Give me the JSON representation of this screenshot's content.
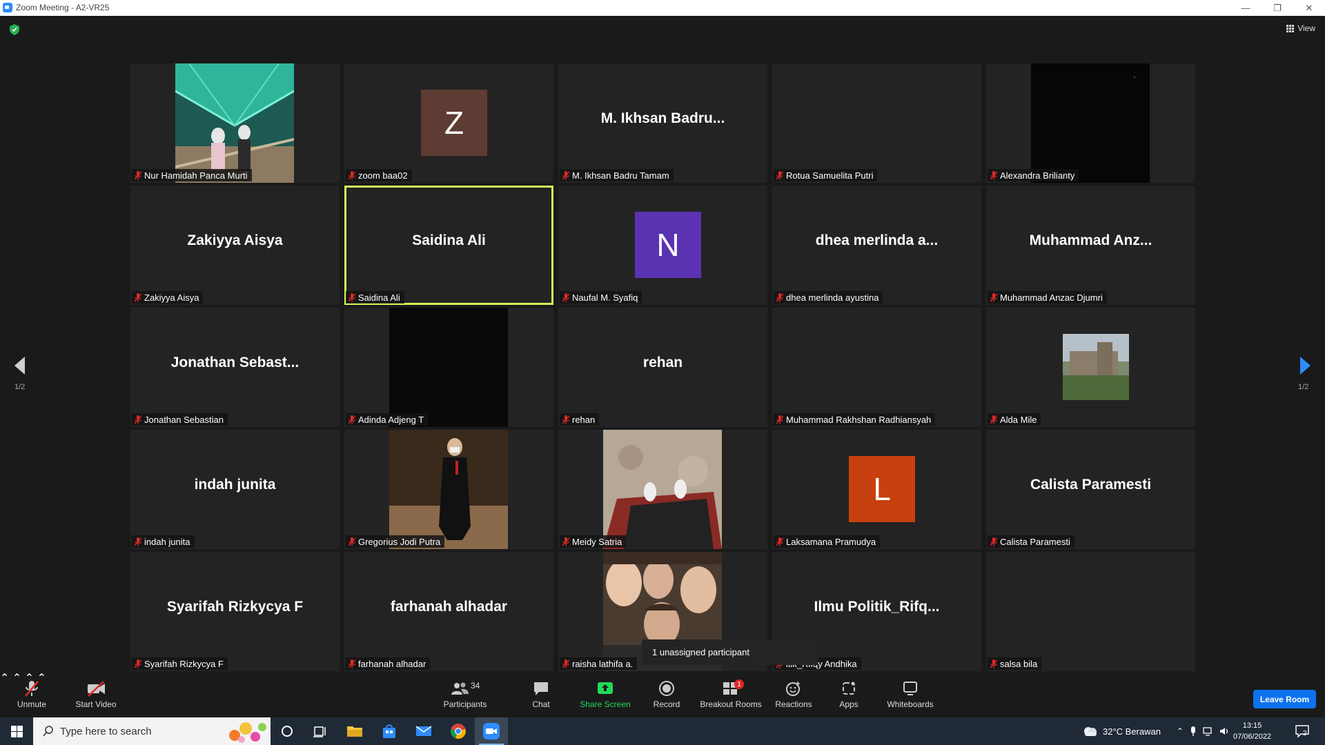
{
  "window": {
    "title": "Zoom Meeting - A2-VR25"
  },
  "view_button": "View",
  "pagination": {
    "left": "1/2",
    "right": "1/2"
  },
  "tiles": [
    {
      "name": "Nur Hamidah Panca Murti",
      "big": "",
      "type": "video",
      "video": "bridge"
    },
    {
      "name": "zoom baa02",
      "big": "",
      "type": "avatar",
      "letter": "Z",
      "color": "#5e3b33"
    },
    {
      "name": "M. Ikhsan Badru Tamam",
      "big": "M. Ikhsan Badru...",
      "type": "name"
    },
    {
      "name": "Rotua Samuelita Putri",
      "big": "",
      "type": "blank"
    },
    {
      "name": "Alexandra Brilianty",
      "big": "",
      "type": "video",
      "video": "dark"
    },
    {
      "name": "Zakiyya Aisya",
      "big": "Zakiyya Aisya",
      "type": "name"
    },
    {
      "name": "Saidina Ali",
      "big": "Saidina Ali",
      "type": "name",
      "active": true
    },
    {
      "name": "Naufal M. Syafiq",
      "big": "",
      "type": "avatar",
      "letter": "N",
      "color": "#5b33b2"
    },
    {
      "name": "dhea merlinda ayustina",
      "big": "dhea merlinda a...",
      "type": "name"
    },
    {
      "name": "Muhammad Anzac Djumri",
      "big": "Muhammad  Anz...",
      "type": "name"
    },
    {
      "name": "Jonathan Sebastian",
      "big": "Jonathan  Sebast...",
      "type": "name"
    },
    {
      "name": "Adinda Adjeng T",
      "big": "",
      "type": "video",
      "video": "black"
    },
    {
      "name": "rehan",
      "big": "rehan",
      "type": "name"
    },
    {
      "name": "Muhammad Rakhshan Radhiansyah",
      "big": "",
      "type": "blank"
    },
    {
      "name": "Alda Mile",
      "big": "",
      "type": "thumb"
    },
    {
      "name": "indah junita",
      "big": "indah junita",
      "type": "name"
    },
    {
      "name": "Gregorius Jodi Putra",
      "big": "",
      "type": "video",
      "video": "suit"
    },
    {
      "name": "Meidy Satria",
      "big": "",
      "type": "video",
      "video": "floor"
    },
    {
      "name": "Laksamana Pramudya",
      "big": "",
      "type": "avatar",
      "letter": "L",
      "color": "#c8400e"
    },
    {
      "name": "Calista Paramesti",
      "big": "Calista Paramesti",
      "type": "name"
    },
    {
      "name": "Syarifah Rizkycya F",
      "big": "Syarifah Rizkycya F",
      "type": "name"
    },
    {
      "name": "farhanah alhadar",
      "big": "farhanah alhadar",
      "type": "name"
    },
    {
      "name": "raisha lathifa a.",
      "big": "",
      "type": "video",
      "video": "group"
    },
    {
      "name": "itik_Rifqy Andhika",
      "big": "Ilmu  Politik_Rifq...",
      "type": "name"
    },
    {
      "name": "salsa bila",
      "big": "",
      "type": "blank"
    }
  ],
  "tooltip": "1 unassigned participant",
  "toolbar": {
    "unmute": "Unmute",
    "start_video": "Start Video",
    "participants": "Participants",
    "participants_count": "34",
    "chat": "Chat",
    "share_screen": "Share Screen",
    "record": "Record",
    "breakout_rooms": "Breakout Rooms",
    "breakout_badge": "1",
    "reactions": "Reactions",
    "apps": "Apps",
    "whiteboards": "Whiteboards",
    "leave_room": "Leave Room"
  },
  "taskbar": {
    "search_placeholder": "Type here to search",
    "weather": "32°C  Berawan",
    "time": "13:15",
    "date": "07/06/2022",
    "notifications": "2"
  },
  "colors": {
    "accent_blue": "#0e72ed",
    "active_border": "#d5f35a",
    "muted_red": "#e02828",
    "share_green": "#23d959"
  }
}
